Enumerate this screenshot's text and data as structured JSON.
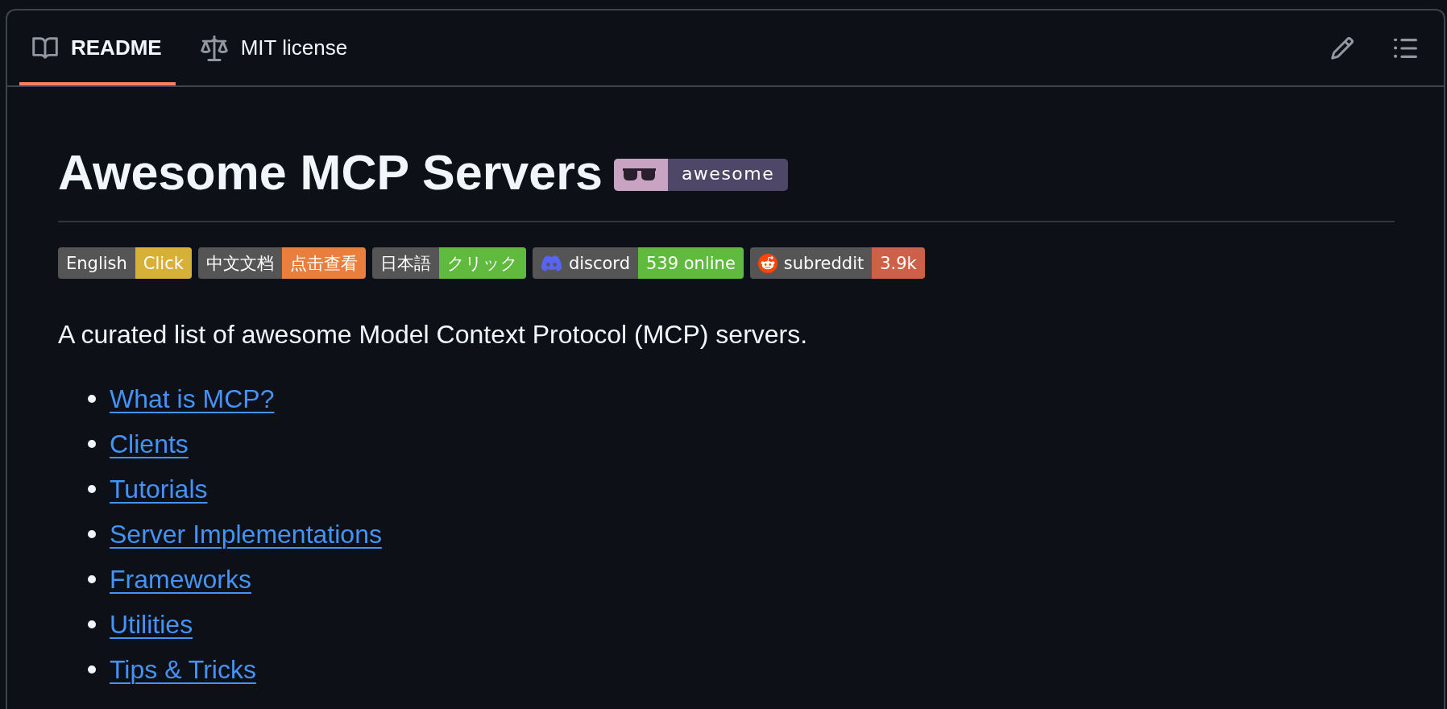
{
  "tabs": [
    {
      "label": "README",
      "kind": "readme",
      "selected": true
    },
    {
      "label": "MIT license",
      "kind": "license",
      "selected": false
    }
  ],
  "title": "Awesome MCP Servers",
  "title_badge": {
    "label": "awesome"
  },
  "badges": [
    {
      "label": "English",
      "value": "Click",
      "color": "#d7b137",
      "kind": "plain"
    },
    {
      "label": "中文文档",
      "value": "点击查看",
      "color": "#ea7f3d",
      "kind": "plain"
    },
    {
      "label": "日本語",
      "value": "クリック",
      "color": "#5fba3e",
      "kind": "plain"
    },
    {
      "label": "discord",
      "value": "539 online",
      "color": "#5fba3e",
      "kind": "discord"
    },
    {
      "label": "subreddit",
      "value": "3.9k",
      "color": "#cc6048",
      "kind": "reddit"
    }
  ],
  "description": "A curated list of awesome Model Context Protocol (MCP) servers.",
  "contents": [
    "What is MCP?",
    "Clients",
    "Tutorials",
    "Server Implementations",
    "Frameworks",
    "Utilities",
    "Tips & Tricks"
  ]
}
